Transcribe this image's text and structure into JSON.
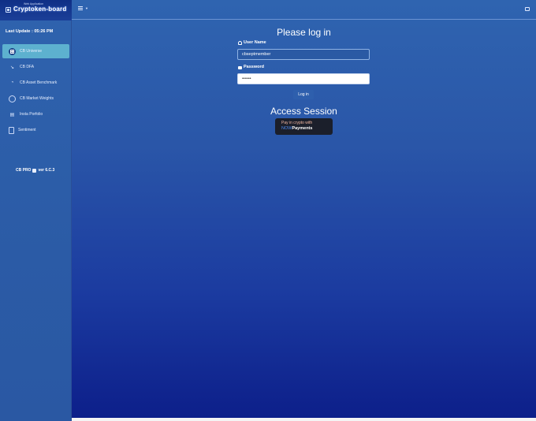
{
  "brand": {
    "subtitle": "Web Application",
    "name": "Cryptoken-board",
    "logo_icon": "cube-logo-icon"
  },
  "sidebar": {
    "last_update": "Last Update : 05:26 PM",
    "items": [
      {
        "label": "CB Universe",
        "icon": "grid-icon",
        "active": true
      },
      {
        "label": "CB DFA",
        "icon": "chart-icon",
        "active": false
      },
      {
        "label": "CB Asset Benchmark",
        "icon": "gauge-icon",
        "active": false
      },
      {
        "label": "CB Market Weights",
        "icon": "pie-icon",
        "active": false
      },
      {
        "label": "Insta Porfolio",
        "icon": "briefcase-icon",
        "active": false
      },
      {
        "label": "Sentiment",
        "icon": "document-icon",
        "active": false
      }
    ],
    "version_prefix": "CB PRO",
    "version_suffix": "ver 6.C.3"
  },
  "topbar": {
    "menu_icon": "hamburger-icon",
    "corner_icon": "window-icon"
  },
  "login": {
    "title": "Please log in",
    "username_label": "User Name",
    "username_value": "cbseptmember",
    "password_label": "Password",
    "password_value": "••••••",
    "button_label": "Log in"
  },
  "access": {
    "title": "Access Session",
    "pay_line1": "Pay in crypto with",
    "pay_now": "NOW",
    "pay_payments": "Payments"
  },
  "colors": {
    "sidebar_active": "#5db1cf",
    "pay_button_bg": "#1b1f2b",
    "now_accent": "#4f8cf0"
  }
}
